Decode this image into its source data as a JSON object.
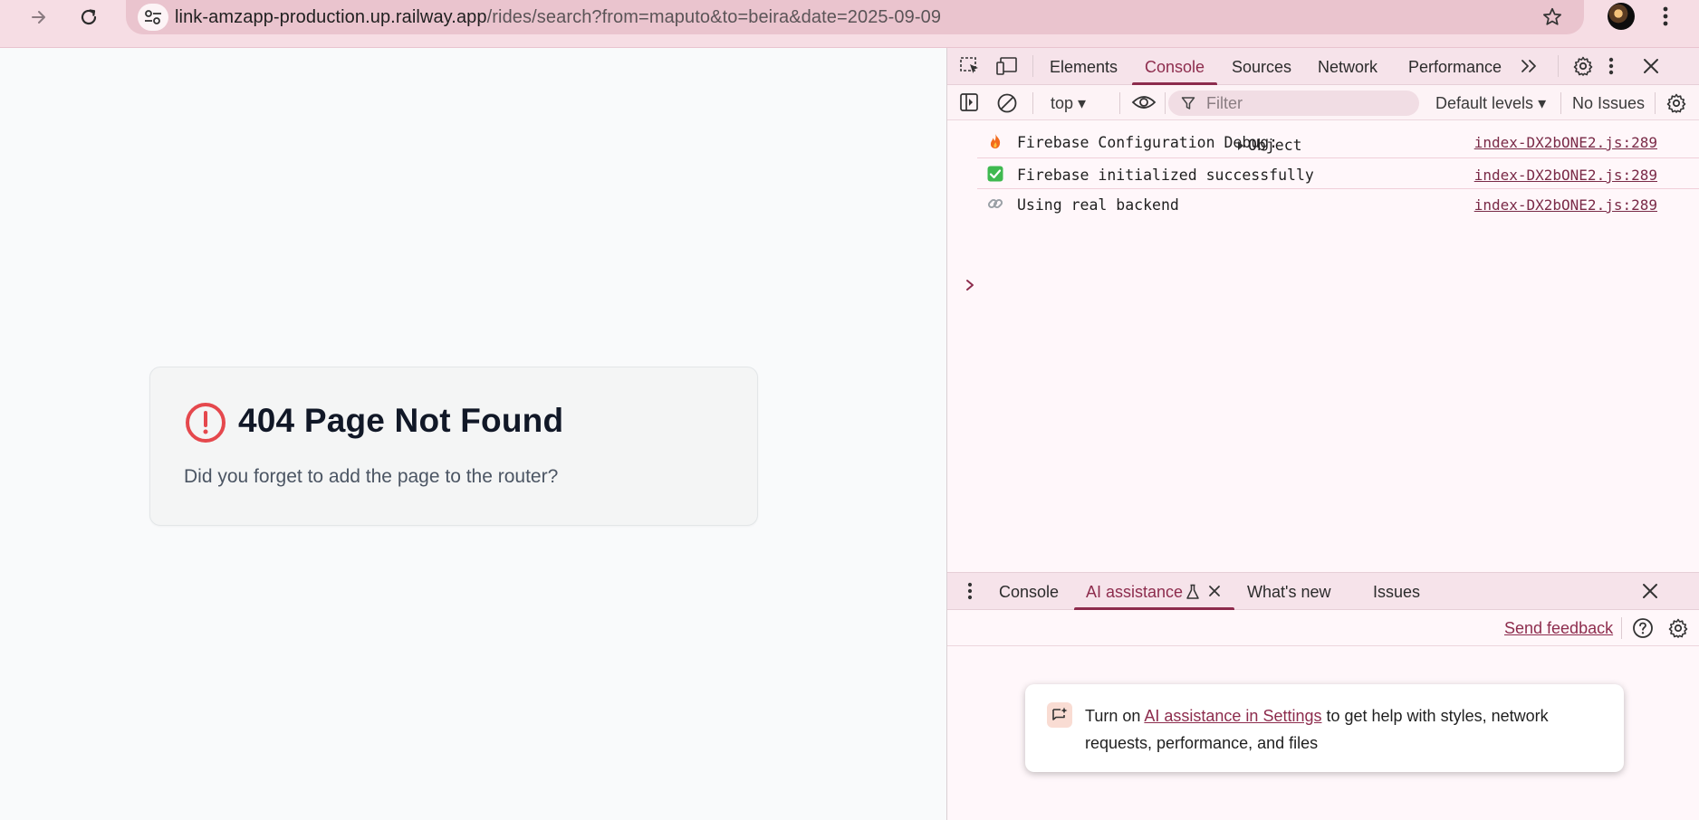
{
  "browser": {
    "url_host": "link-amzapp-production.up.railway.app",
    "url_path": "/rides/search?from=maputo&to=beira&date=2025-09-09",
    "icons": [
      "forward-icon",
      "reload-icon",
      "site-settings-icon",
      "bookmark-star-icon",
      "profile-avatar",
      "more-menu-icon"
    ]
  },
  "page": {
    "title": "404 Page Not Found",
    "message": "Did you forget to add the page to the router?",
    "error_color": "#e5484d"
  },
  "devtools": {
    "tabs": [
      "Elements",
      "Console",
      "Sources",
      "Network",
      "Performance"
    ],
    "active_tab": "Console",
    "toolbar": {
      "context": "top",
      "filter_placeholder": "Filter",
      "levels": "Default levels",
      "issues": "No Issues"
    },
    "logs": [
      {
        "icon": "fire-emoji",
        "message": "Firebase Configuration Debug:",
        "object": "Object",
        "source": "index-DX2bONE2.js:289"
      },
      {
        "icon": "check-emoji",
        "message": "Firebase initialized successfully",
        "source": "index-DX2bONE2.js:289"
      },
      {
        "icon": "link-emoji",
        "message": "Using real backend",
        "source": "index-DX2bONE2.js:289"
      }
    ],
    "drawer": {
      "tabs": [
        "Console",
        "AI assistance",
        "What's new",
        "Issues"
      ],
      "active_tab": "AI assistance",
      "send_feedback": "Send feedback",
      "ai_card": {
        "prefix": "Turn on ",
        "link": "AI assistance in Settings",
        "suffix": " to get help with styles, network requests, performance, and files"
      }
    },
    "accent_color": "#8d2c4d"
  }
}
